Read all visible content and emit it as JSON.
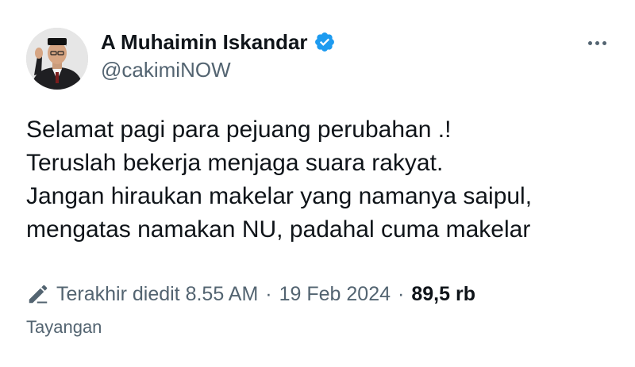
{
  "author": {
    "display_name": "A Muhaimin Iskandar",
    "handle": "@cakimiNOW",
    "verified": true,
    "verified_color": "#1d9bf0"
  },
  "tweet": {
    "lines": [
      "Selamat pagi para pejuang perubahan .!",
      "Teruslah bekerja menjaga suara rakyat.",
      "Jangan hiraukan makelar yang namanya saipul,",
      "mengatas namakan NU, padahal cuma makelar"
    ]
  },
  "meta": {
    "edited_label": "Terakhir diedit 8.55 AM",
    "separator": "·",
    "date": "19 Feb 2024",
    "views_count": "89,5 rb",
    "views_label": "Tayangan"
  },
  "icons": {
    "more": "more-icon",
    "edit": "pencil-edit-icon",
    "verified": "verified-badge-icon"
  },
  "colors": {
    "text_primary": "#0f1419",
    "text_secondary": "#536471",
    "background": "#ffffff"
  }
}
